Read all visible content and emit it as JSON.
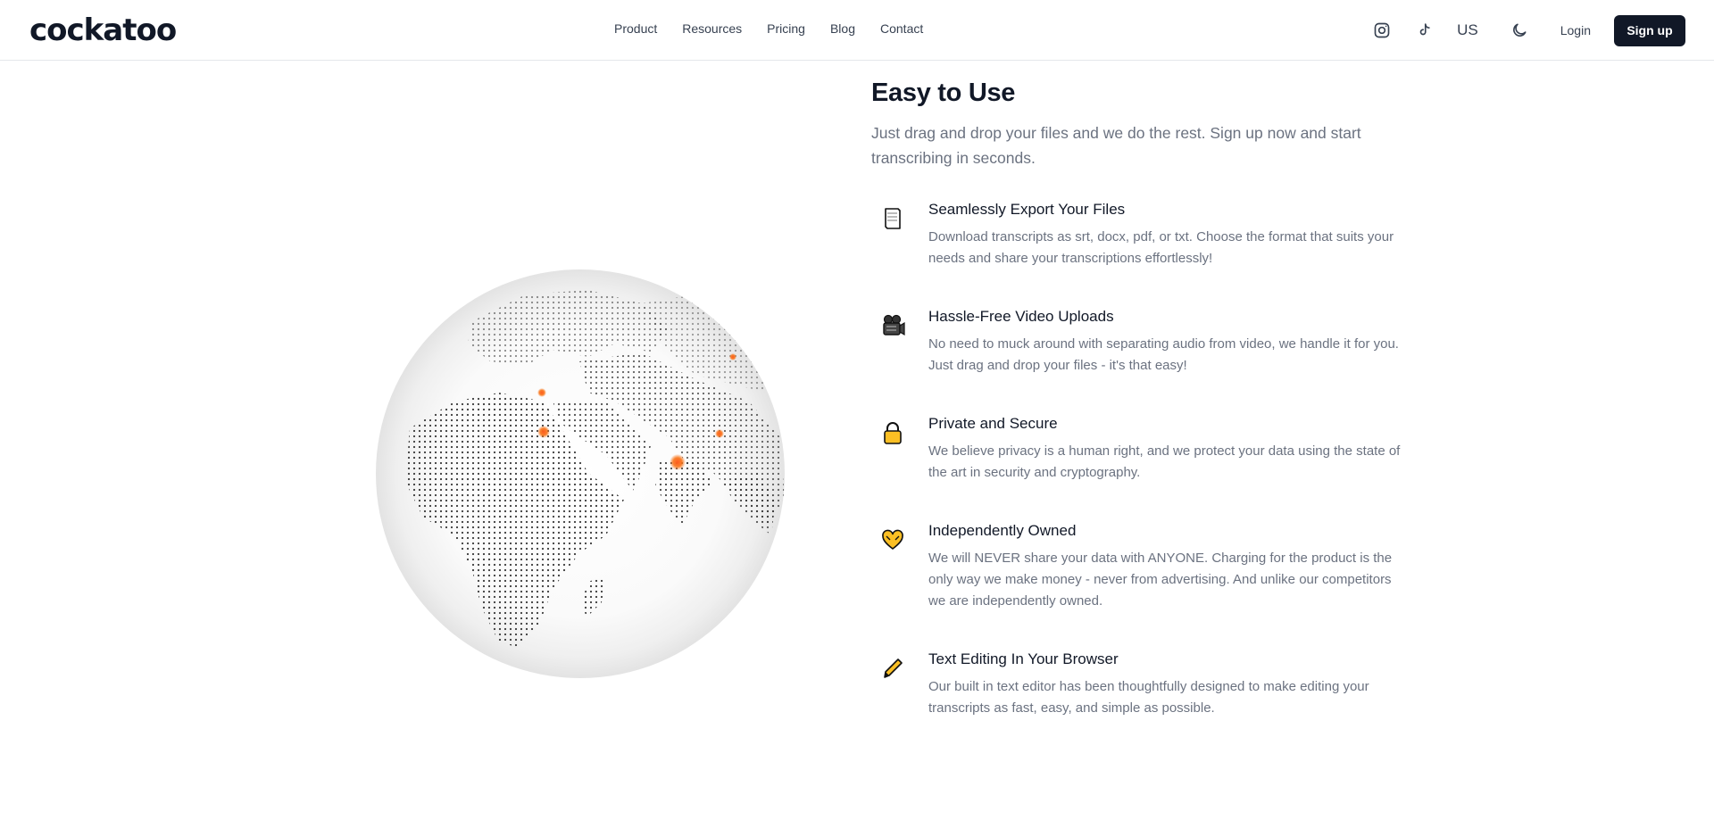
{
  "header": {
    "logo": "cockatoo",
    "nav": [
      "Product",
      "Resources",
      "Pricing",
      "Blog",
      "Contact"
    ],
    "icons": [
      "instagram-icon",
      "tiktok-icon",
      "moon-icon"
    ],
    "locale": "US",
    "login": "Login",
    "signup": "Sign up"
  },
  "section": {
    "title": "Easy to Use",
    "subtitle": "Just drag and drop your files and we do the rest. Sign up now and start transcribing in seconds.",
    "features": [
      {
        "icon": "document-icon",
        "title": "Seamlessly Export Your Files",
        "desc": "Download transcripts as srt, docx, pdf, or txt. Choose the format that suits your needs and share your transcriptions effortlessly!"
      },
      {
        "icon": "video-camera-icon",
        "title": "Hassle-Free Video Uploads",
        "desc": "No need to muck around with separating audio from video, we handle it for you. Just drag and drop your files - it's that easy!"
      },
      {
        "icon": "lock-icon",
        "title": "Private and Secure",
        "desc": "We believe privacy is a human right, and we protect your data using the state of the art in security and cryptography."
      },
      {
        "icon": "heart-hands-icon",
        "title": "Independently Owned",
        "desc": "We will NEVER share your data with ANYONE. Charging for the product is the only way we make money - never from advertising. And unlike our competitors we are independently owned."
      },
      {
        "icon": "pencil-icon",
        "title": "Text Editing In Your Browser",
        "desc": "Our built in text editor has been thoughtfully designed to make editing your transcripts as fast, easy, and simple as possible."
      }
    ]
  },
  "colors": {
    "accent_dark": "#111827",
    "marker": "#f97316",
    "icon_yellow": "#fbbf24"
  }
}
